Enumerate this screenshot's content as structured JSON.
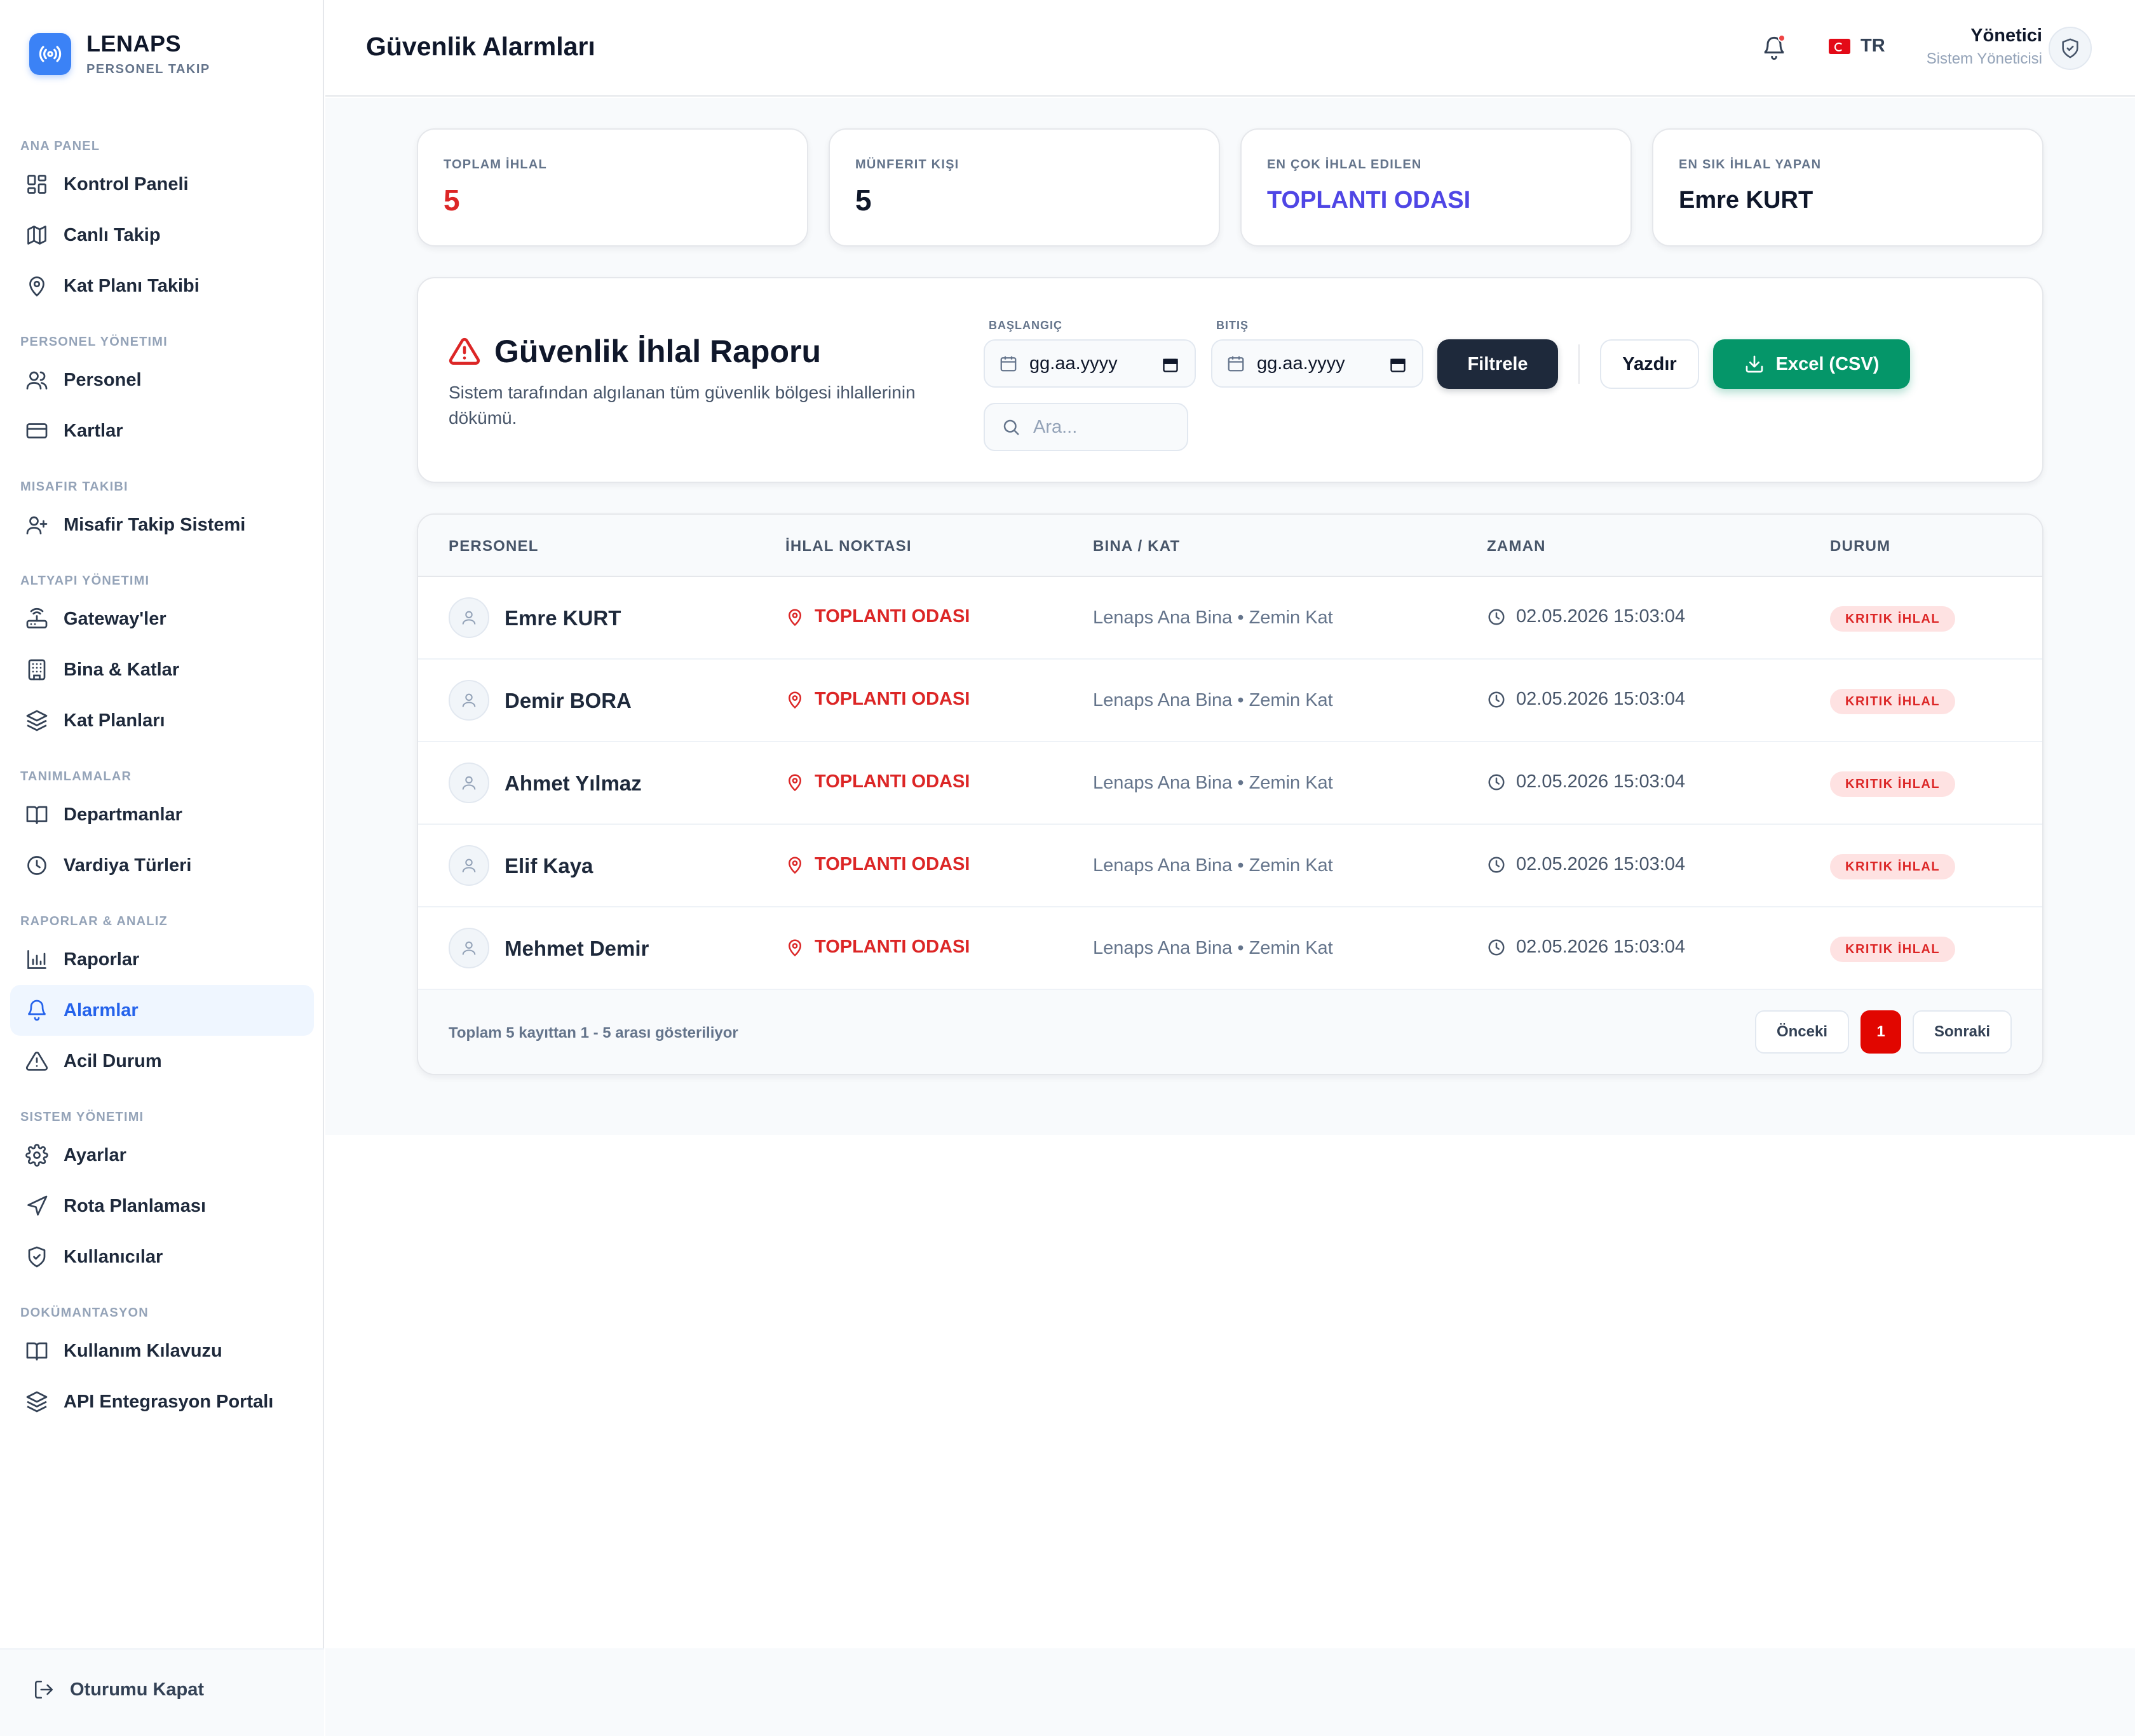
{
  "brand": {
    "title": "LENAPS",
    "subtitle": "PERSONEL TAKIP"
  },
  "sidebar": {
    "sections": [
      {
        "title": "ANA PANEL",
        "items": [
          {
            "label": "Kontrol Paneli",
            "icon": "grid-icon"
          },
          {
            "label": "Canlı Takip",
            "icon": "map-icon"
          },
          {
            "label": "Kat Planı Takibi",
            "icon": "map-pin-icon"
          }
        ]
      },
      {
        "title": "PERSONEL YÖNETIMI",
        "items": [
          {
            "label": "Personel",
            "icon": "users-icon"
          },
          {
            "label": "Kartlar",
            "icon": "credit-card-icon"
          }
        ]
      },
      {
        "title": "MISAFIR TAKIBI",
        "items": [
          {
            "label": "Misafir Takip Sistemi",
            "icon": "user-plus-icon"
          }
        ]
      },
      {
        "title": "ALTYAPI YÖNETIMI",
        "items": [
          {
            "label": "Gateway'ler",
            "icon": "router-icon"
          },
          {
            "label": "Bina & Katlar",
            "icon": "building-icon"
          },
          {
            "label": "Kat Planları",
            "icon": "layers-icon"
          }
        ]
      },
      {
        "title": "TANIMLAMALAR",
        "items": [
          {
            "label": "Departmanlar",
            "icon": "book-open-icon"
          },
          {
            "label": "Vardiya Türleri",
            "icon": "clock-icon"
          }
        ]
      },
      {
        "title": "RAPORLAR & ANALIZ",
        "items": [
          {
            "label": "Raporlar",
            "icon": "bar-chart-icon"
          },
          {
            "label": "Alarmlar",
            "icon": "bell-icon",
            "active": true
          },
          {
            "label": "Acil Durum",
            "icon": "alert-triangle-icon"
          }
        ]
      },
      {
        "title": "SISTEM YÖNETIMI",
        "items": [
          {
            "label": "Ayarlar",
            "icon": "gear-icon"
          },
          {
            "label": "Rota Planlaması",
            "icon": "navigation-icon"
          },
          {
            "label": "Kullanıcılar",
            "icon": "shield-check-icon"
          }
        ]
      },
      {
        "title": "DOKÜMANTASYON",
        "items": [
          {
            "label": "Kullanım Kılavuzu",
            "icon": "book-open-icon"
          },
          {
            "label": "API Entegrasyon Portalı",
            "icon": "layers-icon"
          }
        ]
      }
    ],
    "logout_label": "Oturumu Kapat"
  },
  "header": {
    "title": "Güvenlik Alarmları",
    "lang": "TR",
    "user_name": "Yönetici",
    "user_role": "Sistem Yöneticisi"
  },
  "stats": [
    {
      "title": "TOPLAM İHLAL",
      "value": "5"
    },
    {
      "title": "MÜNFERIT KIŞI",
      "value": "5"
    },
    {
      "title": "EN ÇOK İHLAL EDILEN",
      "value": "TOPLANTI ODASI"
    },
    {
      "title": "EN SIK İHLAL YAPAN",
      "value": "Emre KURT"
    }
  ],
  "report": {
    "title": "Güvenlik İhlal Raporu",
    "description": "Sistem tarafından algılanan tüm güvenlik bölgesi ihlallerinin dökümü.",
    "start_label": "BAŞLANGIÇ",
    "end_label": "BITIŞ",
    "date_placeholder": "gg.aa.yyyy",
    "filter_label": "Filtrele",
    "print_label": "Yazdır",
    "excel_label": "Excel (CSV)",
    "search_placeholder": "Ara..."
  },
  "table": {
    "columns": [
      "PERSONEL",
      "İHLAL NOKTASI",
      "BINA / KAT",
      "ZAMAN",
      "DURUM"
    ],
    "rows": [
      {
        "person": "Emre KURT",
        "point": "TOPLANTI ODASI",
        "location": "Lenaps Ana Bina • Zemin Kat",
        "time": "02.05.2026 15:03:04",
        "status": "KRITIK İHLAL"
      },
      {
        "person": "Demir BORA",
        "point": "TOPLANTI ODASI",
        "location": "Lenaps Ana Bina • Zemin Kat",
        "time": "02.05.2026 15:03:04",
        "status": "KRITIK İHLAL"
      },
      {
        "person": "Ahmet Yılmaz",
        "point": "TOPLANTI ODASI",
        "location": "Lenaps Ana Bina • Zemin Kat",
        "time": "02.05.2026 15:03:04",
        "status": "KRITIK İHLAL"
      },
      {
        "person": "Elif Kaya",
        "point": "TOPLANTI ODASI",
        "location": "Lenaps Ana Bina • Zemin Kat",
        "time": "02.05.2026 15:03:04",
        "status": "KRITIK İHLAL"
      },
      {
        "person": "Mehmet Demir",
        "point": "TOPLANTI ODASI",
        "location": "Lenaps Ana Bina • Zemin Kat",
        "time": "02.05.2026 15:03:04",
        "status": "KRITIK İHLAL"
      }
    ],
    "footer_info": "Toplam 5 kayıttan 1 - 5 arası gösteriliyor",
    "prev_label": "Önceki",
    "current_page": "1",
    "next_label": "Sonraki"
  },
  "colors": {
    "accent": "#2563eb",
    "danger": "#dc2626",
    "success": "#059669",
    "dark": "#1e293b",
    "highlight": "#4f46e5"
  }
}
